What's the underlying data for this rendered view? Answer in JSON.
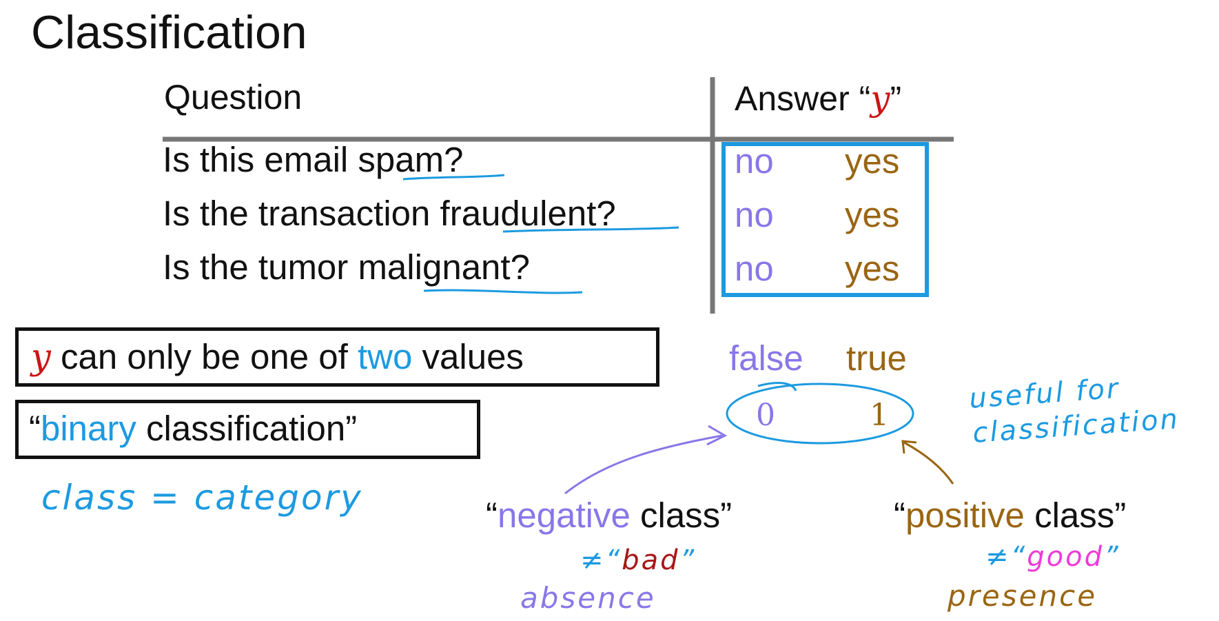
{
  "title": "Classification",
  "table": {
    "question_header": "Question",
    "answer_header_prefix": "Answer “",
    "answer_header_var": "y",
    "answer_header_suffix": "”",
    "rows": [
      {
        "prefix": "Is this email ",
        "keyword": "spam",
        "suffix": "?",
        "no": "no",
        "yes": "yes"
      },
      {
        "prefix": "Is the transaction ",
        "keyword": "fraudulent",
        "suffix": "?",
        "no": "no",
        "yes": "yes"
      },
      {
        "prefix": "Is the tumor ",
        "keyword": "malignant",
        "suffix": "?",
        "no": "no",
        "yes": "yes"
      }
    ]
  },
  "statement": {
    "var": "y",
    "middle": " can only be one of ",
    "highlight": "two",
    "end": " values"
  },
  "binary": {
    "open_quote": "“",
    "highlight": "binary",
    "rest": " classification”"
  },
  "class_note": "class = category",
  "values": {
    "false_label": "false",
    "true_label": "true",
    "zero": "0",
    "one": "1"
  },
  "useful_note": {
    "line1": "useful for",
    "line2": "classification"
  },
  "negative": {
    "open_quote": "“",
    "highlight": "negative",
    "rest": " class”",
    "neq": "≠",
    "quoted_open": "“",
    "quoted_word": "bad",
    "quoted_close": "”",
    "meaning": "absence"
  },
  "positive": {
    "open_quote": "“",
    "highlight": "positive",
    "rest": " class”",
    "neq": "≠",
    "quoted_open": "“",
    "quoted_word": "good",
    "quoted_close": "”",
    "meaning": "presence"
  }
}
